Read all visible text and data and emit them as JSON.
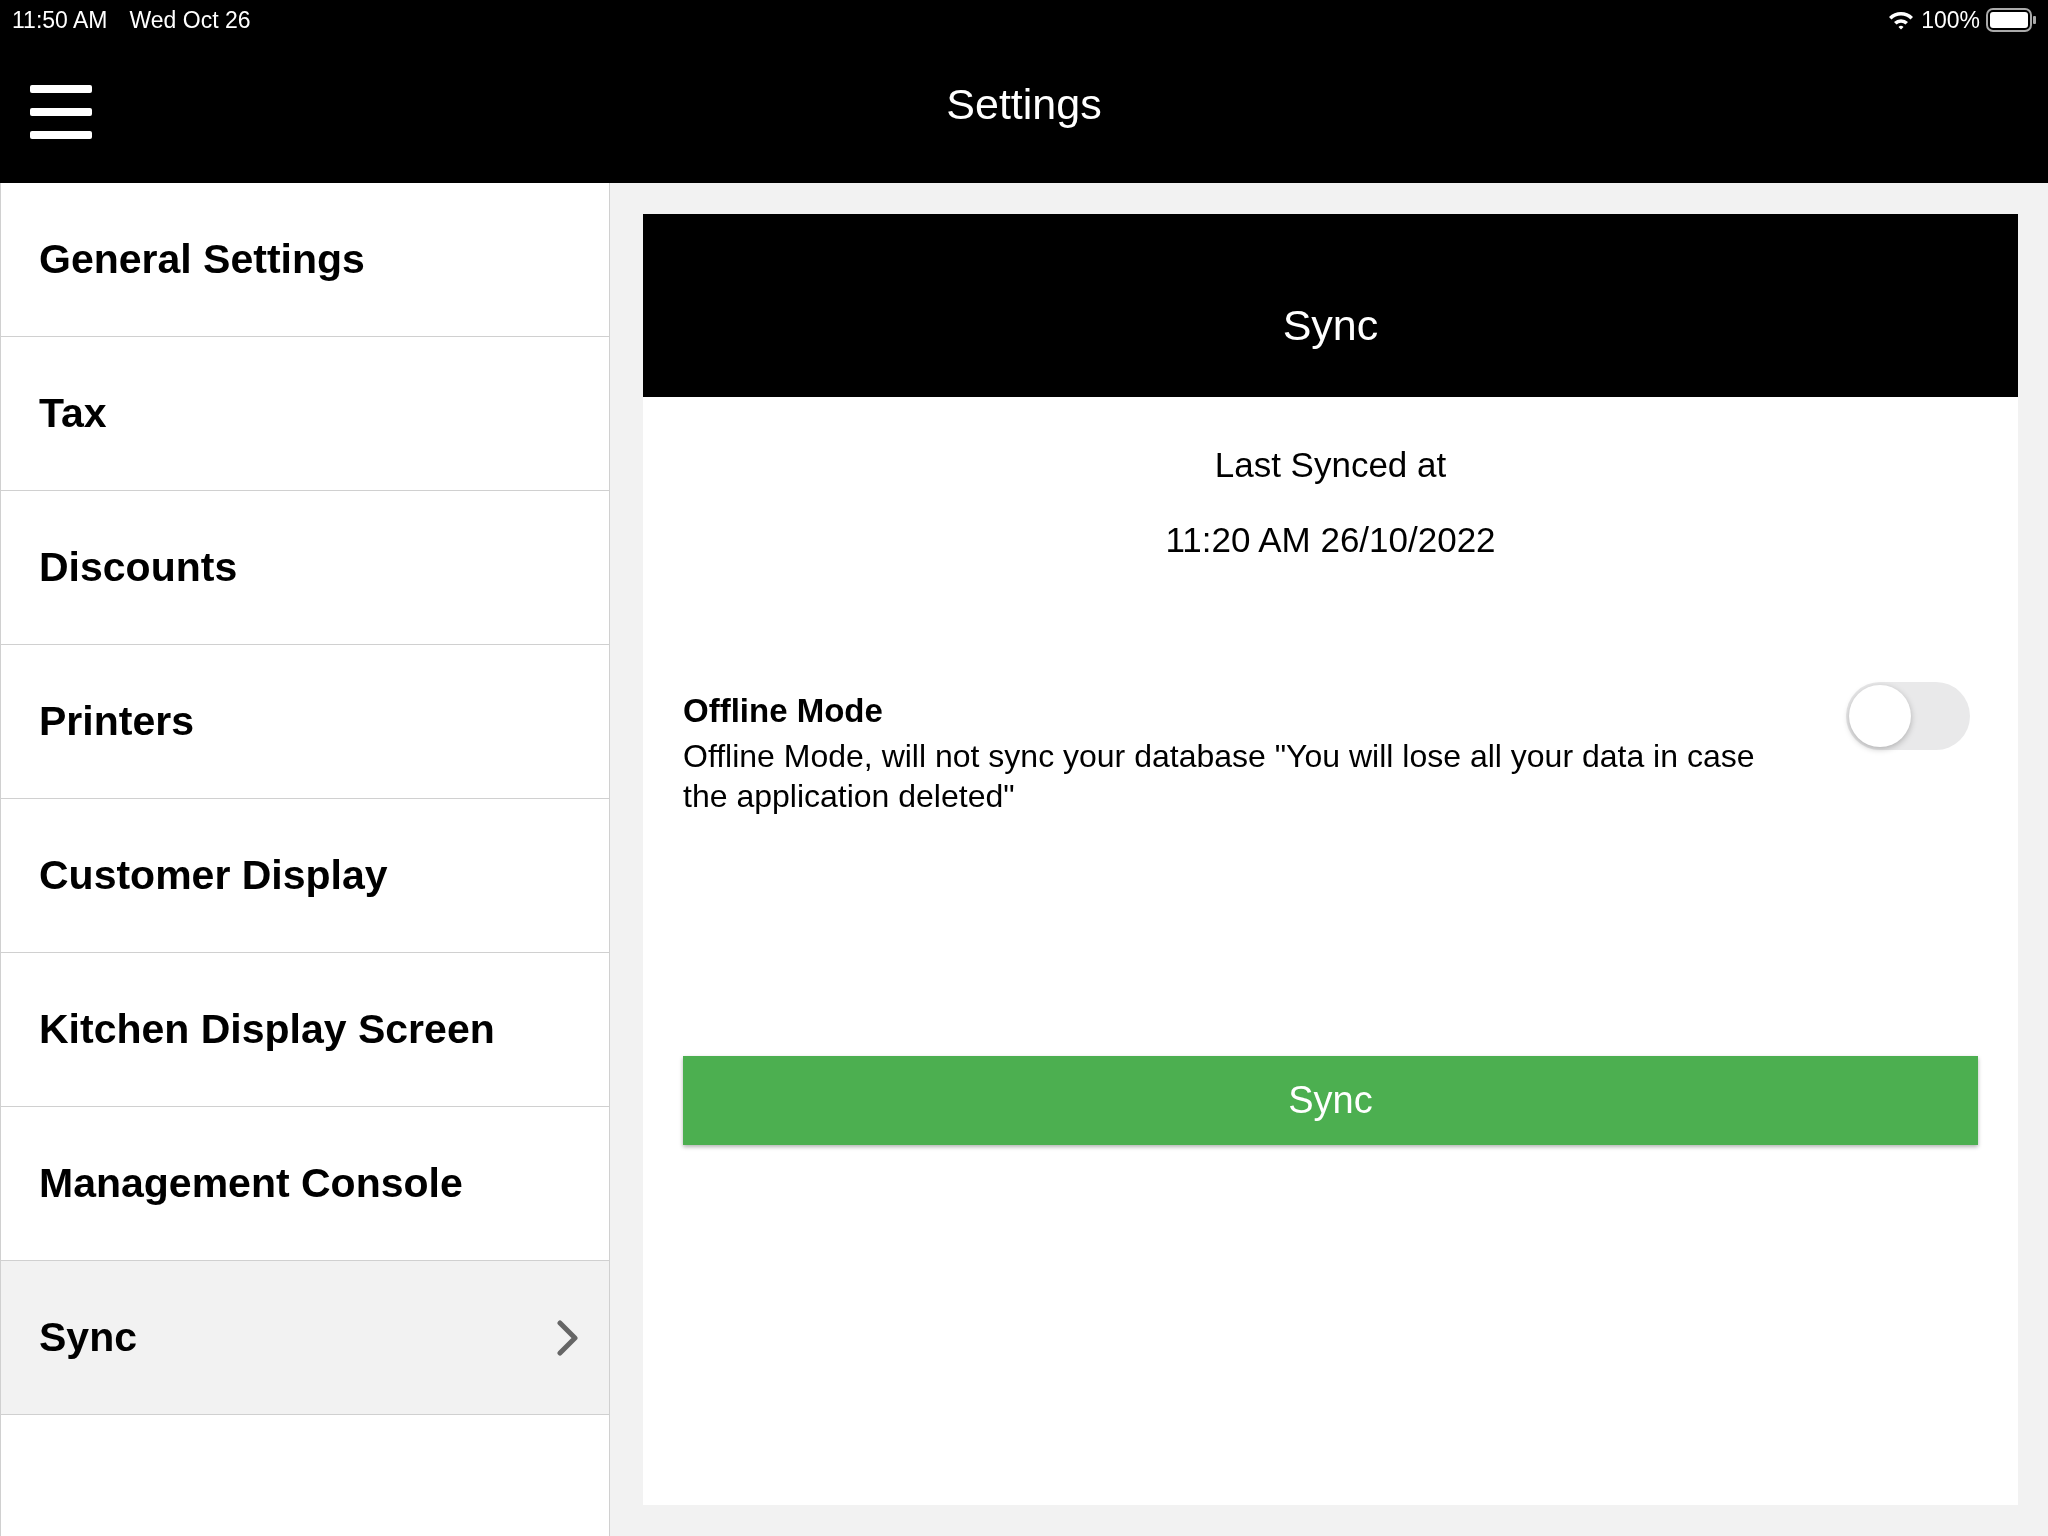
{
  "status_bar": {
    "time": "11:50 AM",
    "date": "Wed Oct 26",
    "battery": "100%"
  },
  "header": {
    "title": "Settings"
  },
  "sidebar": {
    "items": [
      {
        "label": "General Settings",
        "selected": false
      },
      {
        "label": "Tax",
        "selected": false
      },
      {
        "label": "Discounts",
        "selected": false
      },
      {
        "label": "Printers",
        "selected": false
      },
      {
        "label": "Customer Display",
        "selected": false
      },
      {
        "label": "Kitchen Display Screen",
        "selected": false
      },
      {
        "label": "Management Console",
        "selected": false
      },
      {
        "label": "Sync",
        "selected": true
      }
    ]
  },
  "panel": {
    "title": "Sync",
    "last_synced_label": "Last Synced at",
    "last_synced_value": "11:20 AM 26/10/2022",
    "offline_mode": {
      "title": "Offline Mode",
      "description": "Offline Mode, will not sync your database \"You will lose all your data in case the application deleted\"",
      "on": false
    },
    "button": "Sync"
  }
}
